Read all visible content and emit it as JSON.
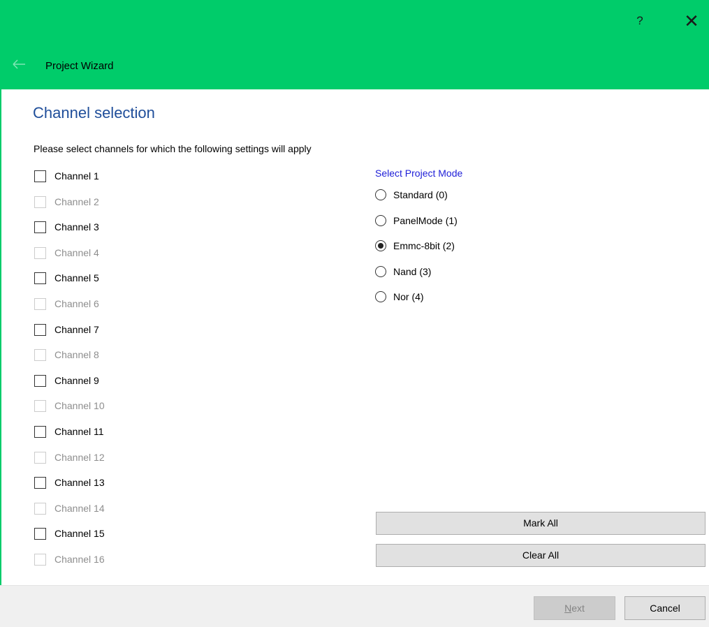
{
  "window": {
    "accent_color": "#00cc6a",
    "help_glyph": "?",
    "close_glyph": "✕",
    "back_icon": "arrow-left-icon",
    "title": "Project Wizard"
  },
  "page": {
    "title": "Channel selection",
    "instructions": "Please select channels for which the following settings will apply"
  },
  "channels": [
    {
      "label": "Channel 1",
      "enabled": true,
      "checked": false
    },
    {
      "label": "Channel 2",
      "enabled": false,
      "checked": false
    },
    {
      "label": "Channel 3",
      "enabled": true,
      "checked": false
    },
    {
      "label": "Channel 4",
      "enabled": false,
      "checked": false
    },
    {
      "label": "Channel 5",
      "enabled": true,
      "checked": false
    },
    {
      "label": "Channel 6",
      "enabled": false,
      "checked": false
    },
    {
      "label": "Channel 7",
      "enabled": true,
      "checked": false
    },
    {
      "label": "Channel 8",
      "enabled": false,
      "checked": false
    },
    {
      "label": "Channel 9",
      "enabled": true,
      "checked": false
    },
    {
      "label": "Channel 10",
      "enabled": false,
      "checked": false
    },
    {
      "label": "Channel 11",
      "enabled": true,
      "checked": false
    },
    {
      "label": "Channel 12",
      "enabled": false,
      "checked": false
    },
    {
      "label": "Channel 13",
      "enabled": true,
      "checked": false
    },
    {
      "label": "Channel 14",
      "enabled": false,
      "checked": false
    },
    {
      "label": "Channel 15",
      "enabled": true,
      "checked": false
    },
    {
      "label": "Channel 16",
      "enabled": false,
      "checked": false
    }
  ],
  "project_mode": {
    "title": "Select Project Mode",
    "title_color": "#2020d8",
    "options": [
      {
        "label": "Standard (0)",
        "checked": false
      },
      {
        "label": "PanelMode (1)",
        "checked": false
      },
      {
        "label": "Emmc-8bit (2)",
        "checked": true
      },
      {
        "label": "Nand (3)",
        "checked": false
      },
      {
        "label": "Nor (4)",
        "checked": false
      }
    ]
  },
  "actions": {
    "mark_all": "Mark All",
    "clear_all": "Clear All"
  },
  "footer": {
    "next_first_letter": "N",
    "next_rest": "ext",
    "next_enabled": false,
    "cancel": "Cancel"
  }
}
